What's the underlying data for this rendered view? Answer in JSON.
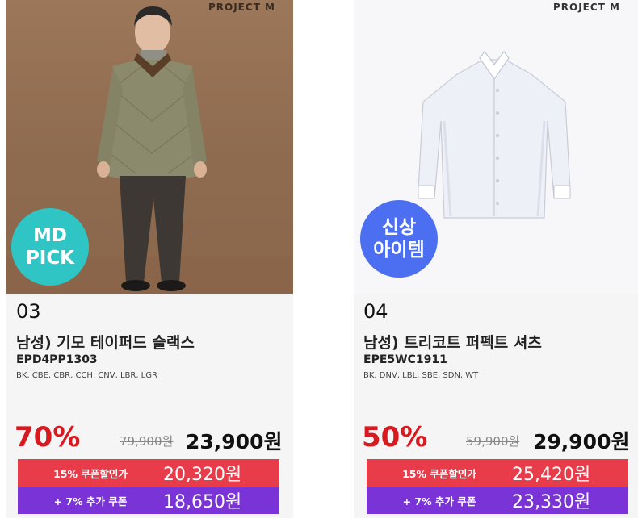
{
  "products": [
    {
      "brand": "PROJECT M",
      "badge_line1": "MD",
      "badge_line2": "PICK",
      "number": "03",
      "name": "남성) 기모 테이퍼드 슬랙스",
      "code": "EPD4PP1303",
      "colors": "BK, CBE, CBR, CCH, CNV, LBR, LGR",
      "discount": "70%",
      "original_price": "79,900원",
      "sale_price": "23,900원",
      "coupon1_label": "15% 쿠폰할인가",
      "coupon1_price": "20,320원",
      "coupon2_label": "+ 7% 추가 쿠폰",
      "coupon2_price": "18,650원",
      "badge_color": "#2ec5c4"
    },
    {
      "brand": "PROJECT M",
      "badge_line1": "신상",
      "badge_line2": "아이템",
      "number": "04",
      "name": "남성) 트리코트 퍼펙트 셔츠",
      "code": "EPE5WC1911",
      "colors": "BK, DNV, LBL, SBE, SDN, WT",
      "discount": "50%",
      "original_price": "59,900원",
      "sale_price": "29,900원",
      "coupon1_label": "15% 쿠폰할인가",
      "coupon1_price": "25,420원",
      "coupon2_label": "+ 7% 추가 쿠폰",
      "coupon2_price": "23,330원",
      "badge_color": "#4b6ff0"
    }
  ],
  "colors": {
    "discount_red": "#d71920",
    "coupon_red": "#e83c4b",
    "coupon_purple": "#7a33d6"
  }
}
